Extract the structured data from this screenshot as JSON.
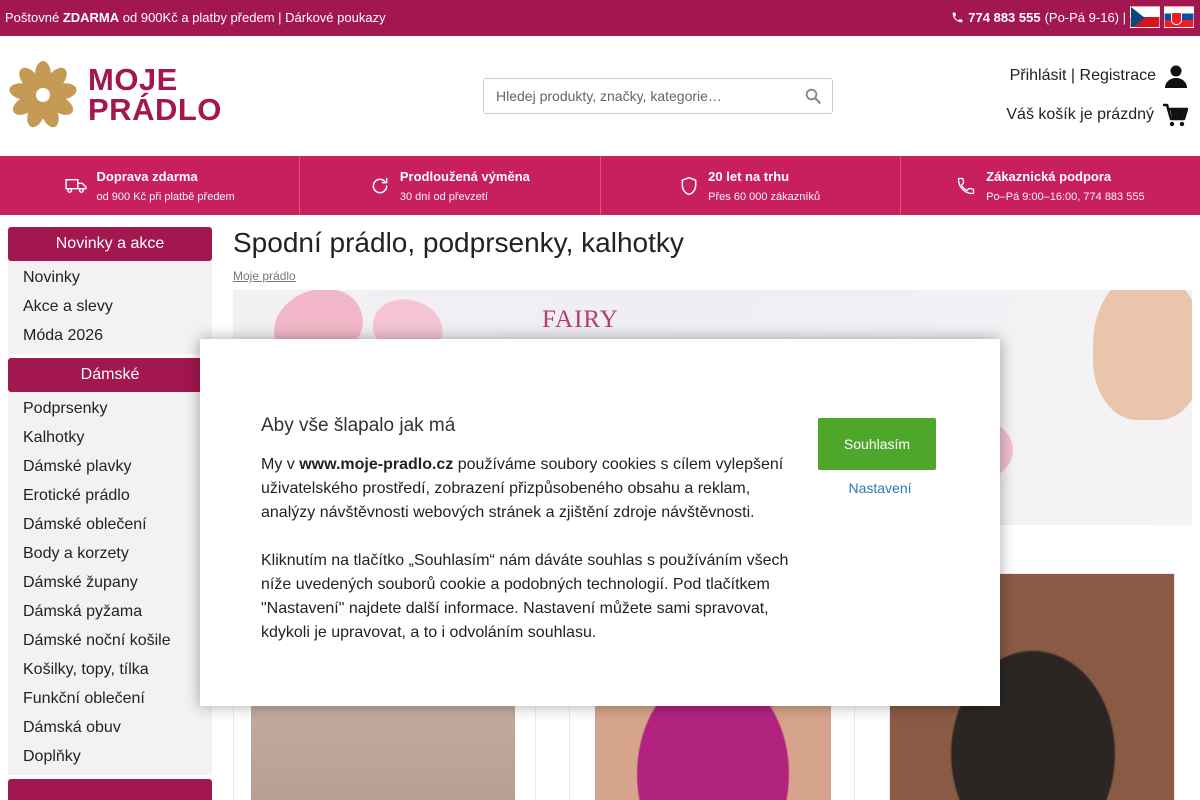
{
  "topbar": {
    "shipping_prefix": "Poštovné ",
    "shipping_bold": "ZDARMA",
    "shipping_suffix": " od 900Kč a platby předem | Dárkové poukazy",
    "phone": "774 883 555",
    "hours": " (Po-Pá 9-16) |",
    "flags": [
      {
        "name": "cz-flag"
      },
      {
        "name": "sk-flag"
      }
    ]
  },
  "header": {
    "logo_line1": "MOJE",
    "logo_line2": "PRÁDLO",
    "search_placeholder": "Hledej produkty, značky, kategorie…",
    "account_text": "Přihlásit | Registrace",
    "cart_text": "Váš košík je prázdný"
  },
  "benefits": [
    {
      "title": "Doprava zdarma",
      "sub": "od 900 Kč při platbě předem",
      "icon": "truck-icon"
    },
    {
      "title": "Prodloužená výměna",
      "sub": "30 dní od převzetí",
      "icon": "refresh-icon"
    },
    {
      "title": "20 let na trhu",
      "sub": "Přes 60 000 zákazníků",
      "icon": "shield-icon"
    },
    {
      "title": "Zákaznická podpora",
      "sub": "Po–Pá 9:00–16:00, 774 883 555",
      "icon": "phone-icon"
    }
  ],
  "sidebar": {
    "sections": [
      {
        "title": "Novinky a akce",
        "items": [
          "Novinky",
          "Akce a slevy",
          "Móda 2026"
        ]
      },
      {
        "title": "Dámské",
        "items": [
          "Podprsenky",
          "Kalhotky",
          "Dámské plavky",
          "Erotické prádlo",
          "Dámské oblečení",
          "Body a korzety",
          "Dámské župany",
          "Dámská pyžama",
          "Dámské noční košile",
          "Košilky, topy, tílka",
          "Funkční oblečení",
          "Dámská obuv",
          "Doplňky"
        ]
      }
    ]
  },
  "main": {
    "title": "Spodní prádlo, podprsenky, kalhotky",
    "breadcrumb": "Moje prádlo",
    "banner_text": "FAIRY"
  },
  "cookie_modal": {
    "title": "Aby vše šlapalo jak má",
    "p1_prefix": "My v ",
    "p1_bold": "www.moje-pradlo.cz",
    "p1_suffix": " používáme soubory cookies s cílem vylepšení uživatelského prostředí, zobrazení přizpůsobeného obsahu a reklam, analýzy návštěvnosti webových stránek a zjištění zdroje návštěvnosti.",
    "p2": "Kliknutím na tlačítko „Souhlasím“ nám dáváte souhlas s používáním všech níže uvedených souborů cookie a podobných technologií. Pod tlačítkem \"Nastavení\" najdete další informace. Nastavení můžete sami spravovat, kdykoli je upravovat, a to i odvoláním souhlasu.",
    "agree_label": "Souhlasím",
    "settings_label": "Nastavení"
  },
  "colors": {
    "brand": "#a2174f",
    "benefits_bg": "#c8205e",
    "agree_green": "#4ea62a",
    "link_blue": "#2a78b5"
  }
}
